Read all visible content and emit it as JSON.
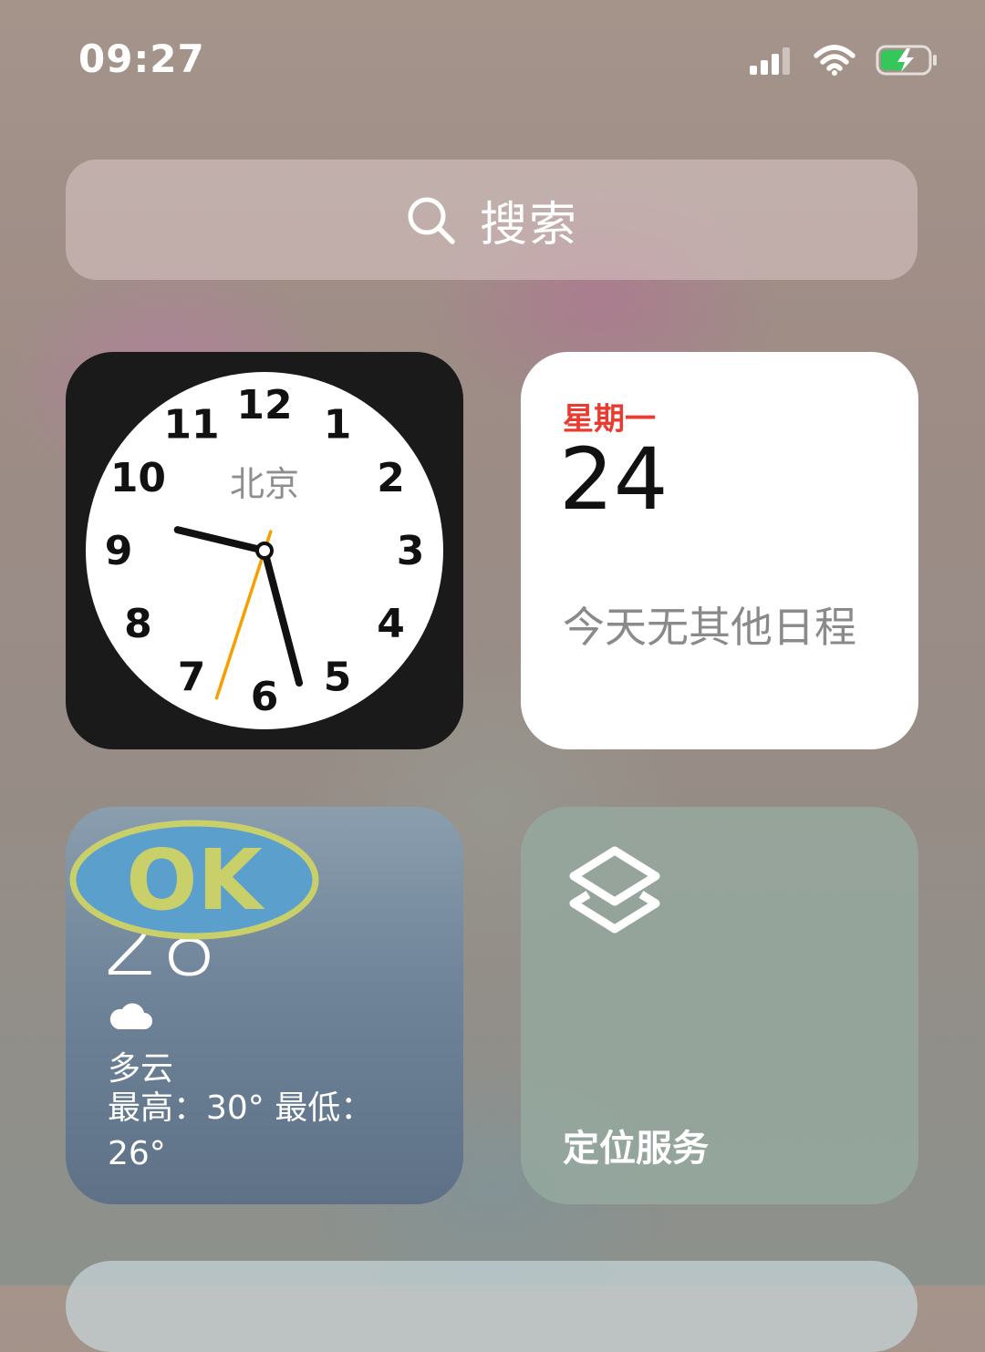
{
  "status_bar": {
    "time": "09:27",
    "icons": [
      "cellular-signal-icon",
      "wifi-icon",
      "battery-charging-icon"
    ],
    "battery_color": "#34c759"
  },
  "search": {
    "label": "搜索",
    "icon": "search-icon"
  },
  "clock_widget": {
    "city": "北京",
    "numbers": [
      "12",
      "1",
      "2",
      "3",
      "4",
      "5",
      "6",
      "7",
      "8",
      "9",
      "10",
      "11"
    ],
    "time": {
      "hour": 9,
      "minute": 27,
      "second": 33
    },
    "second_hand_color": "#f5a000"
  },
  "calendar_widget": {
    "weekday": "星期一",
    "day": "24",
    "note": "今天无其他日程",
    "accent_color": "#ea3b30"
  },
  "weather_widget": {
    "overlay_badge": "OK",
    "temperature": "28",
    "icon": "cloud-icon",
    "condition": "多云",
    "range": "最高：30° 最低：26°"
  },
  "shortcut_widget": {
    "icon": "shortcuts-layers-icon",
    "label": "定位服务"
  }
}
